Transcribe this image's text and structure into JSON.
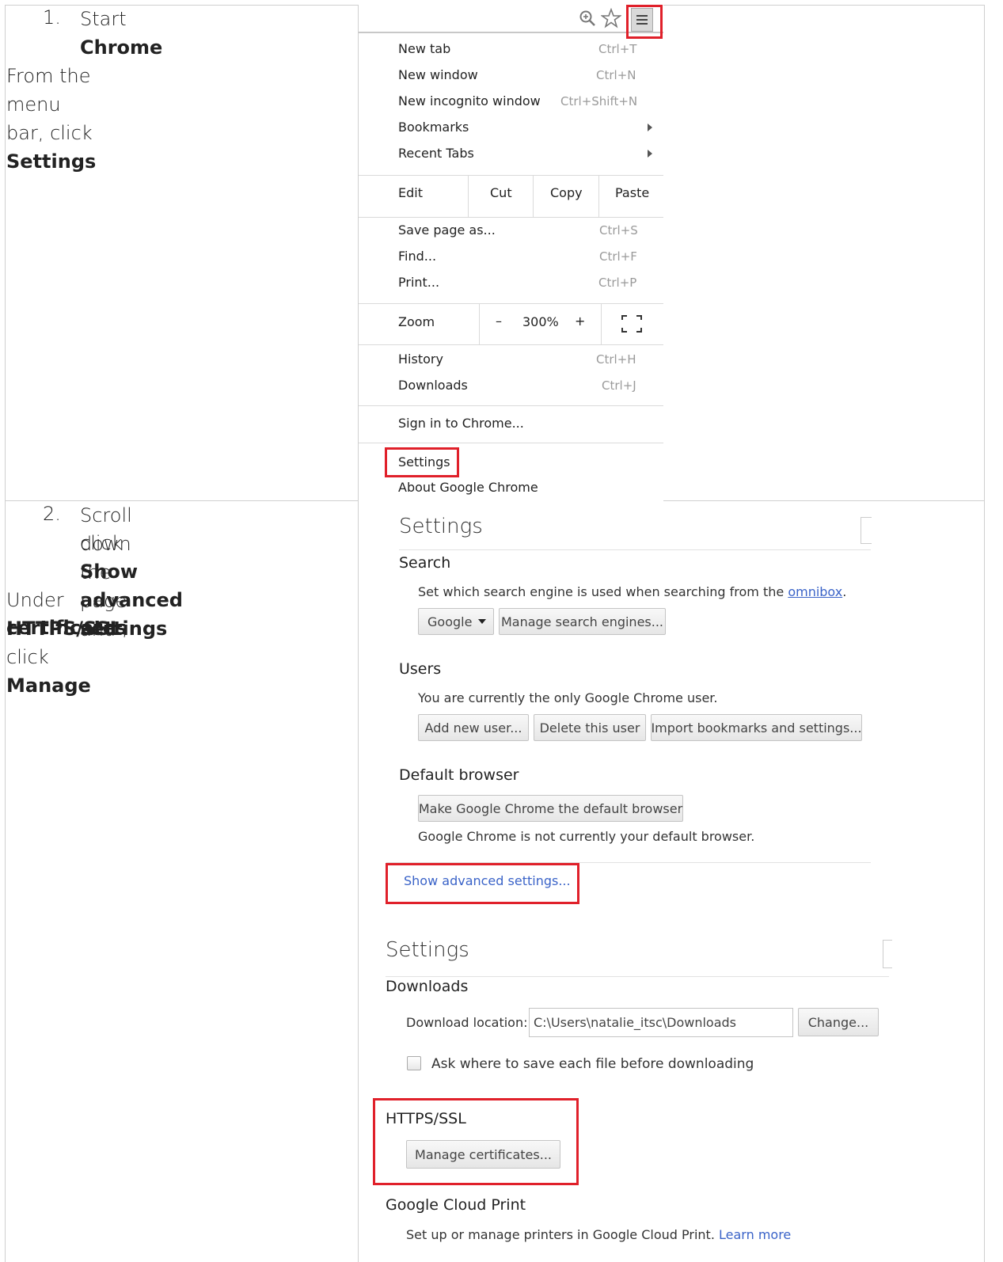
{
  "steps": [
    {
      "number": "1.",
      "title_prefix": "Start ",
      "title_bold": "Chrome",
      "instruction_prefix": "From the menu bar, click ",
      "instruction_bold": "Settings"
    },
    {
      "number": "2.",
      "title_line1": "Scroll down the page and",
      "title_prefix": "click ",
      "title_bold": "Show advanced settings",
      "instruction_prefix": "Under ",
      "instruction_bold1": "HTTPS/SSL",
      "instruction_mid": ", click ",
      "instruction_bold2a": "Manage",
      "instruction_bold2b": "certificates"
    }
  ],
  "chrome_menu": {
    "icons": [
      "zoom-icon",
      "star-icon",
      "hamburger-menu-icon"
    ],
    "items_group1": [
      {
        "label": "New tab",
        "shortcut": "Ctrl+T"
      },
      {
        "label": "New window",
        "shortcut": "Ctrl+N"
      },
      {
        "label": "New incognito window",
        "shortcut": "Ctrl+Shift+N"
      },
      {
        "label": "Bookmarks",
        "submenu": true
      },
      {
        "label": "Recent Tabs",
        "submenu": true
      }
    ],
    "edit_row": {
      "label": "Edit",
      "cut": "Cut",
      "copy": "Copy",
      "paste": "Paste"
    },
    "items_group2": [
      {
        "label": "Save page as...",
        "shortcut": "Ctrl+S"
      },
      {
        "label": "Find...",
        "shortcut": "Ctrl+F"
      },
      {
        "label": "Print...",
        "shortcut": "Ctrl+P"
      }
    ],
    "zoom_row": {
      "label": "Zoom",
      "minus": "–",
      "value": "300%",
      "plus": "+"
    },
    "items_group3": [
      {
        "label": "History",
        "shortcut": "Ctrl+H"
      },
      {
        "label": "Downloads",
        "shortcut": "Ctrl+J"
      }
    ],
    "sign_in": "Sign in to Chrome...",
    "settings": "Settings",
    "about": "About Google Chrome"
  },
  "settings_page1": {
    "title": "Settings",
    "search": {
      "heading": "Search",
      "text_prefix": "Set which search engine is used when searching from the ",
      "link": "omnibox",
      "text_suffix": ".",
      "engine_select": "Google",
      "manage_button": "Manage search engines..."
    },
    "users": {
      "heading": "Users",
      "text": "You are currently the only Google Chrome user.",
      "add_button": "Add new user...",
      "delete_button": "Delete this user",
      "import_button": "Import bookmarks and settings..."
    },
    "default_browser": {
      "heading": "Default browser",
      "make_default_button": "Make Google Chrome the default browser",
      "status": "Google Chrome is not currently your default browser."
    },
    "show_advanced": "Show advanced settings..."
  },
  "settings_page2": {
    "title": "Settings",
    "downloads": {
      "heading": "Downloads",
      "location_label": "Download location:",
      "location_value": "C:\\Users\\natalie_itsc\\Downloads",
      "change_button": "Change...",
      "ask_checkbox_label": "Ask where to save each file before downloading",
      "ask_checked": false
    },
    "https": {
      "heading": "HTTPS/SSL",
      "manage_button": "Manage certificates..."
    },
    "cloud_print": {
      "heading": "Google Cloud Print",
      "text": "Set up or manage printers in Google Cloud Print.",
      "learn_more": "Learn more"
    }
  },
  "colors": {
    "highlight_red": "#e0202a",
    "link_blue": "#3a63c8"
  }
}
